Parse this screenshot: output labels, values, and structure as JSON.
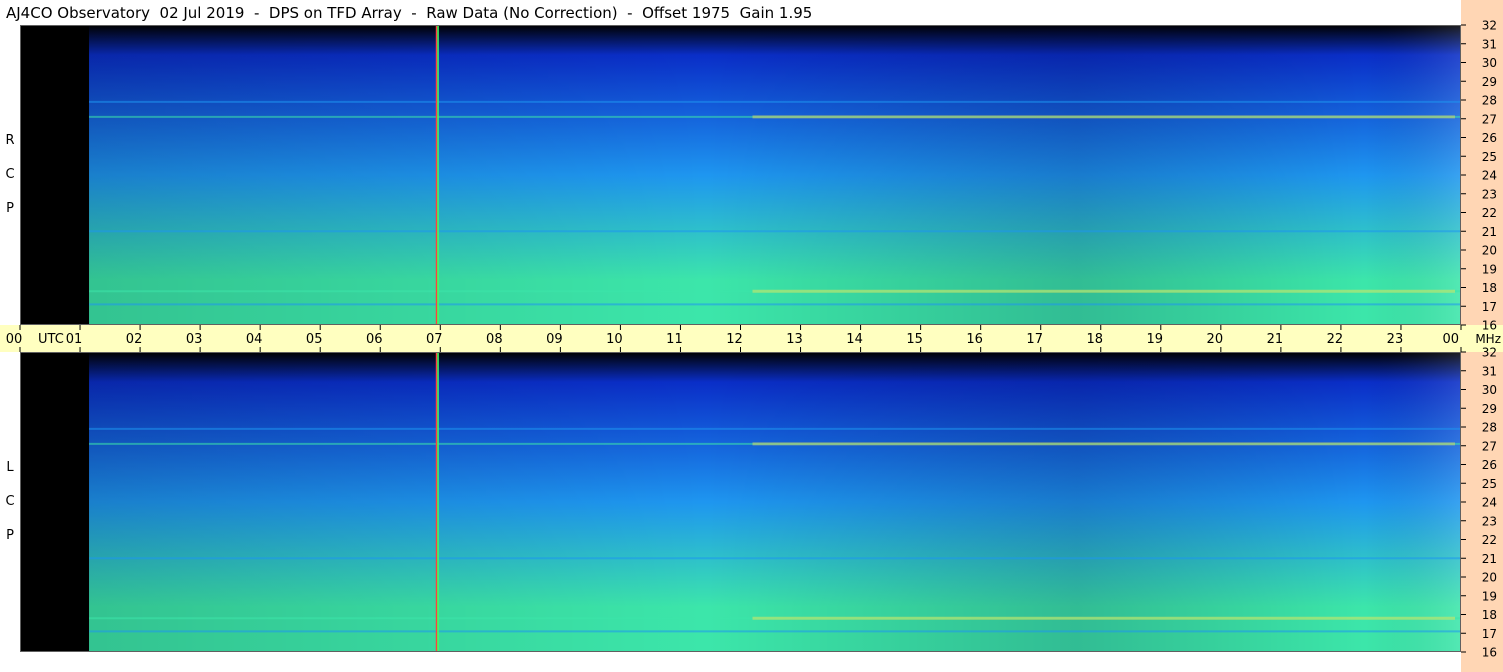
{
  "title": "AJ4CO Observatory  02 Jul 2019  -  DPS on TFD Array  -  Raw Data (No Correction)  -  Offset 1975  Gain 1.95",
  "panels": {
    "top": {
      "label": [
        "R",
        "C",
        "P"
      ]
    },
    "bottom": {
      "label": [
        "L",
        "C",
        "P"
      ]
    }
  },
  "chart_data": {
    "type": "heatmap",
    "x_axis": {
      "unit_label": "UTC",
      "range_hours": [
        0,
        24
      ],
      "tick_labels": [
        "00",
        "01",
        "02",
        "03",
        "04",
        "05",
        "06",
        "07",
        "08",
        "09",
        "10",
        "11",
        "12",
        "13",
        "14",
        "15",
        "16",
        "17",
        "18",
        "19",
        "20",
        "21",
        "22",
        "23",
        "00"
      ]
    },
    "y_axis": {
      "unit_label": "MHz",
      "range_mhz": [
        16,
        32
      ],
      "tick_labels": [
        "32",
        "31",
        "30",
        "29",
        "28",
        "27",
        "26",
        "25",
        "24",
        "23",
        "22",
        "21",
        "20",
        "19",
        "18",
        "17",
        "16"
      ]
    },
    "data_start_hour": 1.15,
    "features": {
      "rfi_line_hour": 6.95,
      "persistent_bands_mhz": [
        27.1,
        27.9,
        21.0,
        17.8,
        17.1
      ],
      "background_gradient": "dark blue at high MHz to cyan/green at low MHz"
    },
    "colors": {
      "frame": "#c8c8c8",
      "axis_band": "#ffffc0",
      "scale_band": "#ffd6b4",
      "no_data": "#000000",
      "low_power": "#0a2ec8",
      "mid_power": "#1e96f0",
      "high_power": "#3ce6aa",
      "peak_power": "#ffe650"
    }
  }
}
